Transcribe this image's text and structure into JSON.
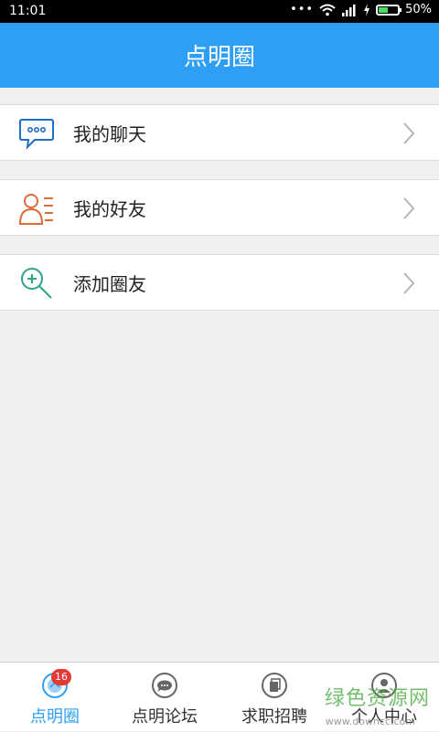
{
  "status_bar": {
    "time": "11:01",
    "battery_text": "50%",
    "battery_level": 0.5
  },
  "header": {
    "title": "点明圈"
  },
  "menu": {
    "items": [
      {
        "label": "我的聊天",
        "icon": "chat-bubble-icon"
      },
      {
        "label": "我的好友",
        "icon": "friends-icon"
      },
      {
        "label": "添加圈友",
        "icon": "search-add-icon"
      }
    ]
  },
  "bottom_nav": {
    "items": [
      {
        "label": "点明圈",
        "icon": "circle-icon",
        "badge": "16",
        "active": true
      },
      {
        "label": "点明论坛",
        "icon": "forum-icon"
      },
      {
        "label": "求职招聘",
        "icon": "jobs-icon"
      },
      {
        "label": "个人中心",
        "icon": "person-icon"
      }
    ]
  },
  "watermark": {
    "text": "绿色资源网",
    "sub": "www.downcc.com"
  },
  "colors": {
    "accent": "#2e9ff4",
    "chat": "#1f6fc4",
    "friends": "#e06a3a",
    "search": "#2aa58a",
    "badge": "#e53935"
  }
}
